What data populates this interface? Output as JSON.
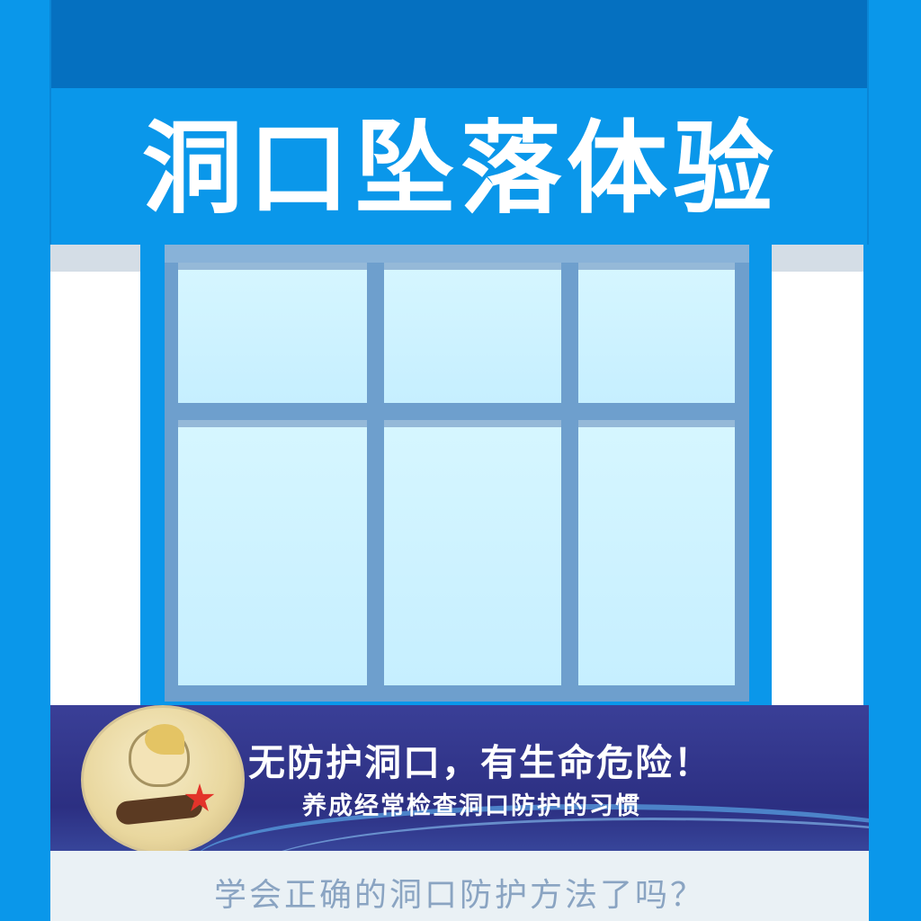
{
  "booth": {
    "title": "洞口坠落体验",
    "colors": {
      "wall_blue": "#0a97ea",
      "roof_dark_blue": "#0570c0",
      "window_frame": "#6e9fcd",
      "glass": "#d6f6ff",
      "banner_navy": "#2c2f82"
    }
  },
  "window": {
    "panes": [
      {
        "name": "pane-top-left"
      },
      {
        "name": "pane-top-middle"
      },
      {
        "name": "pane-top-right"
      },
      {
        "name": "pane-bottom-left"
      },
      {
        "name": "pane-bottom-middle"
      },
      {
        "name": "pane-bottom-right"
      }
    ]
  },
  "banner": {
    "headline": "无防护洞口，有生命危险！",
    "subline": "养成经常检查洞口防护的习惯",
    "emblem_icon": "falling-worker-icon"
  },
  "footer": {
    "question": "学会正确的洞口防护方法了吗？"
  }
}
